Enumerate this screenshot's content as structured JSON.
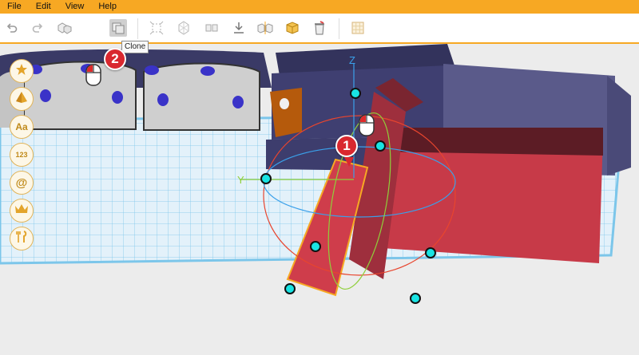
{
  "menu": {
    "file": "File",
    "edit": "Edit",
    "view": "View",
    "help": "Help"
  },
  "toolbar": {
    "tools": [
      "undo-icon",
      "redo-icon",
      "group-icon",
      "clone-icon",
      "align-icon",
      "pattern-icon",
      "mirror-icon",
      "download-icon",
      "split-icon",
      "box-icon",
      "delete-icon",
      "grid-icon"
    ],
    "tooltip": "Clone"
  },
  "sidebar": {
    "items": [
      {
        "name": "favorites",
        "icon": "star-icon"
      },
      {
        "name": "shapes",
        "icon": "pyramid-icon"
      },
      {
        "name": "text",
        "label": "Aa",
        "icon": "text-icon"
      },
      {
        "name": "numbers",
        "label": "123",
        "icon": "numbers-icon"
      },
      {
        "name": "symbols",
        "label": "@",
        "icon": "at-icon"
      },
      {
        "name": "premium",
        "icon": "crown-icon"
      },
      {
        "name": "tools",
        "icon": "tools-icon"
      }
    ]
  },
  "steps": {
    "step1": "1",
    "step2": "2"
  },
  "gizmo": {
    "z_label": "Z",
    "y_label": "Y"
  },
  "colors": {
    "accent": "#f7a823",
    "gizmo_handle": "#19e3e3",
    "selected_block": "#cf3d4b",
    "badge": "#d9282f"
  }
}
